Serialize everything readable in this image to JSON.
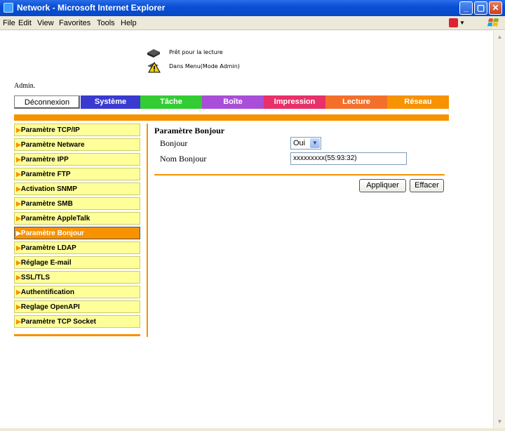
{
  "window": {
    "title": "Network - Microsoft Internet Explorer"
  },
  "menubar": {
    "items": [
      "File",
      "Edit",
      "View",
      "Favorites",
      "Tools",
      "Help"
    ]
  },
  "status": {
    "line1": "Prêt pour la lecture",
    "line2": "Dans Menu(Mode Admin)"
  },
  "admin_label": "Admin.",
  "tabs": [
    {
      "label": "Déconnexion",
      "color": "#ffffff"
    },
    {
      "label": "Système",
      "color": "#3a3ad0"
    },
    {
      "label": "Tâche",
      "color": "#33cc33"
    },
    {
      "label": "Boîte",
      "color": "#a84ed8"
    },
    {
      "label": "Impression",
      "color": "#e8306a"
    },
    {
      "label": "Lecture",
      "color": "#f4702a"
    },
    {
      "label": "Réseau",
      "color": "#f79200"
    }
  ],
  "sidebar": {
    "items": [
      {
        "label": "Paramètre TCP/IP"
      },
      {
        "label": "Paramètre Netware"
      },
      {
        "label": "Paramètre IPP"
      },
      {
        "label": "Paramètre FTP"
      },
      {
        "label": "Activation SNMP"
      },
      {
        "label": "Paramètre SMB"
      },
      {
        "label": "Paramètre AppleTalk"
      },
      {
        "label": "Paramètre Bonjour",
        "active": true
      },
      {
        "label": "Paramètre LDAP"
      },
      {
        "label": "Réglage E-mail"
      },
      {
        "label": "SSL/TLS"
      },
      {
        "label": "Authentification"
      },
      {
        "label": "Reglage OpenAPI"
      },
      {
        "label": "Paramètre TCP Socket"
      }
    ]
  },
  "main": {
    "title": "Paramètre Bonjour",
    "bonjour_label": "Bonjour",
    "bonjour_value": "Oui",
    "name_label": "Nom Bonjour",
    "name_value": "xxxxxxxxx(55:93:32)",
    "apply_label": "Appliquer",
    "clear_label": "Effacer"
  },
  "colors": {
    "accent": "#f79200",
    "sidebar_bg": "#ffff99"
  }
}
